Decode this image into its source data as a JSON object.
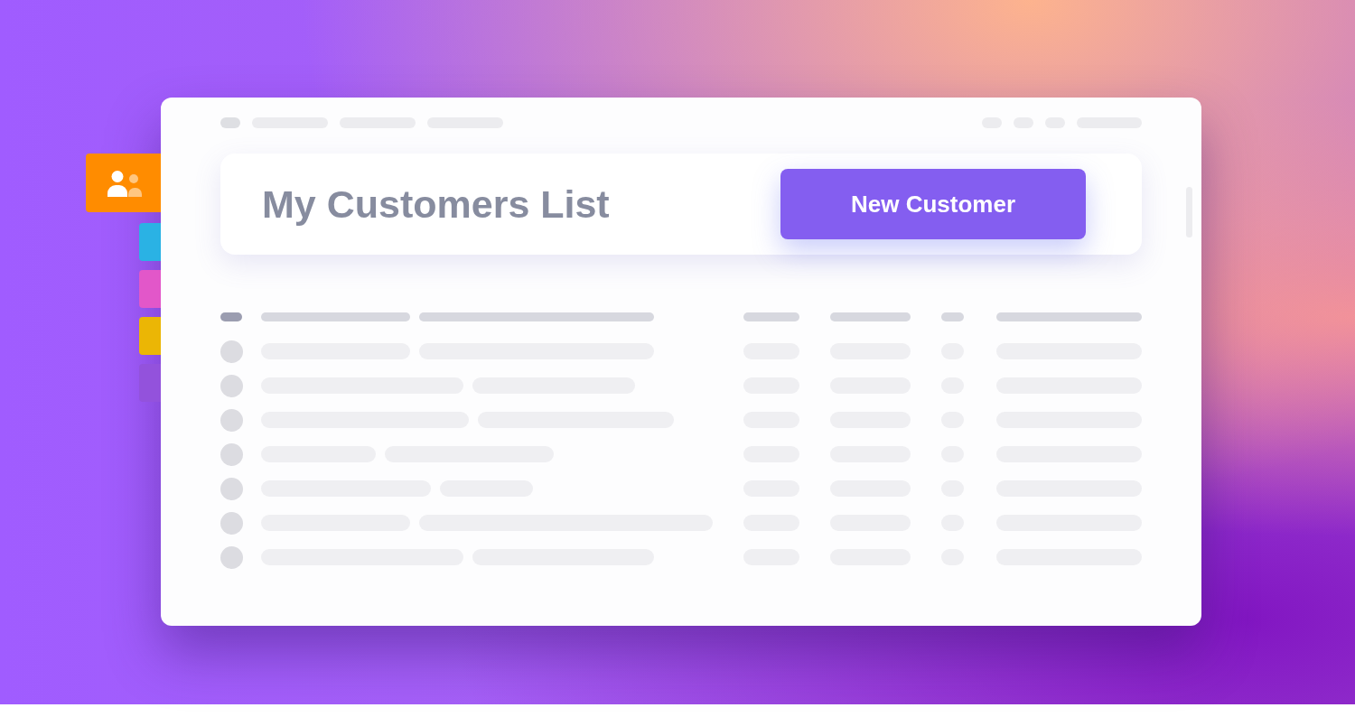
{
  "side_tabs": [
    {
      "color": "#ff8c00",
      "selected": true
    },
    {
      "color": "#2ab2e4",
      "selected": false
    },
    {
      "color": "#e257c9",
      "selected": false
    },
    {
      "color": "#ebb605",
      "selected": false
    },
    {
      "color": "#9352dc",
      "selected": false
    }
  ],
  "header": {
    "title": "My Customers List",
    "button": "New Customer"
  }
}
